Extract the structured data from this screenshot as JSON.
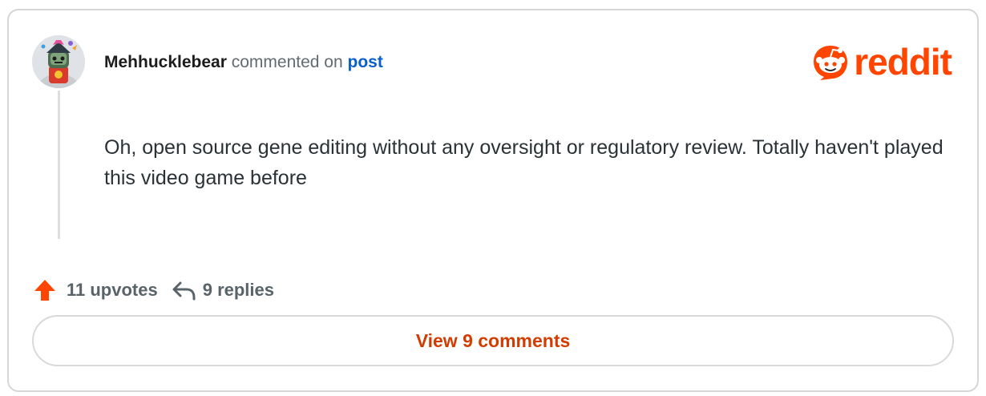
{
  "comment": {
    "username": "Mehhucklebear",
    "action_text": "commented on",
    "post_link": "post",
    "body": "Oh, open source gene editing without any oversight or regulatory review. Totally haven't played this video game before"
  },
  "brand": {
    "wordmark": "reddit",
    "color": "#ff4500",
    "icon": "reddit-snoo-icon"
  },
  "stats": {
    "upvotes": "11 upvotes",
    "replies": "9 replies",
    "upvote_icon": "upvote-arrow-icon",
    "reply_icon": "reply-arrow-icon"
  },
  "actions": {
    "view_comments": "View 9 comments"
  }
}
